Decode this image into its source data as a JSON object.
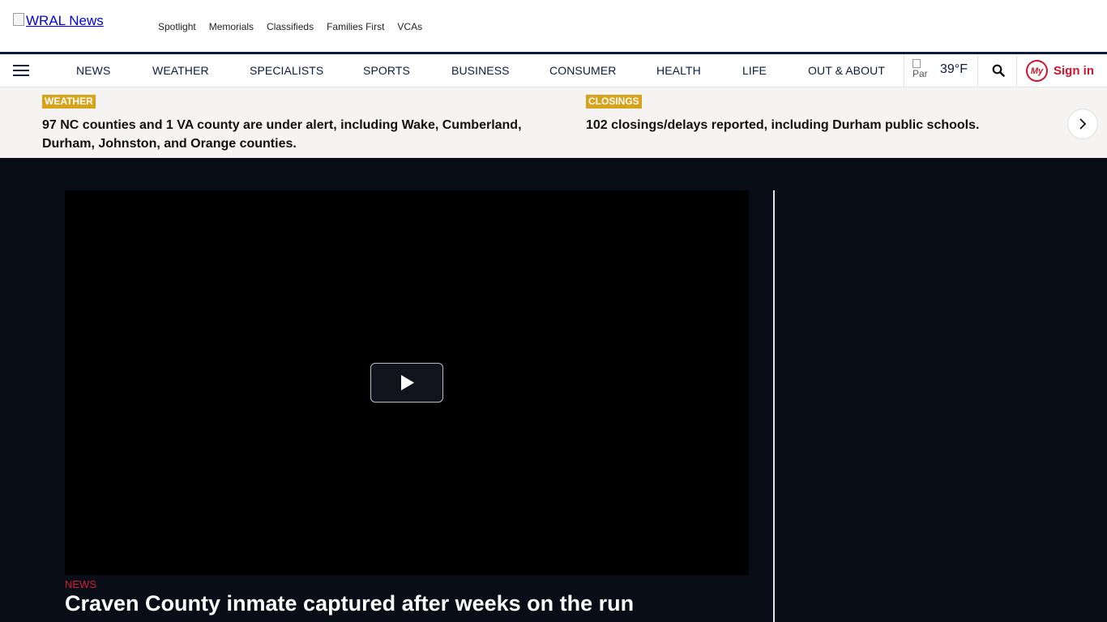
{
  "header": {
    "logo_alt": "WRAL News",
    "utility_links": [
      "Spotlight",
      "Memorials",
      "Classifieds",
      "Families First",
      "VCAs"
    ]
  },
  "nav": {
    "items": [
      "NEWS",
      "WEATHER",
      "SPECIALISTS",
      "SPORTS",
      "BUSINESS",
      "CONSUMER",
      "HEALTH",
      "LIFE",
      "OUT & ABOUT"
    ],
    "weather": {
      "icon_alt": "Par",
      "temperature": "39°F"
    },
    "signin": {
      "badge": "My",
      "label": "Sign in"
    }
  },
  "alerts": [
    {
      "tag": "WEATHER",
      "message": "97 NC counties and 1 VA county are under alert, including Wake, Cumberland, Durham, Johnston, and Orange counties."
    },
    {
      "tag": "CLOSINGS",
      "message": "102 closings/delays reported, including Durham public schools."
    }
  ],
  "hero": {
    "category": "NEWS",
    "headline": "Craven County inmate captured after weeks on the run"
  },
  "colors": {
    "nav_text": "#0d1b3e",
    "brand_red": "#d0142c",
    "alert_tag": "#d9a21b",
    "hero_bg": "#080d18"
  }
}
